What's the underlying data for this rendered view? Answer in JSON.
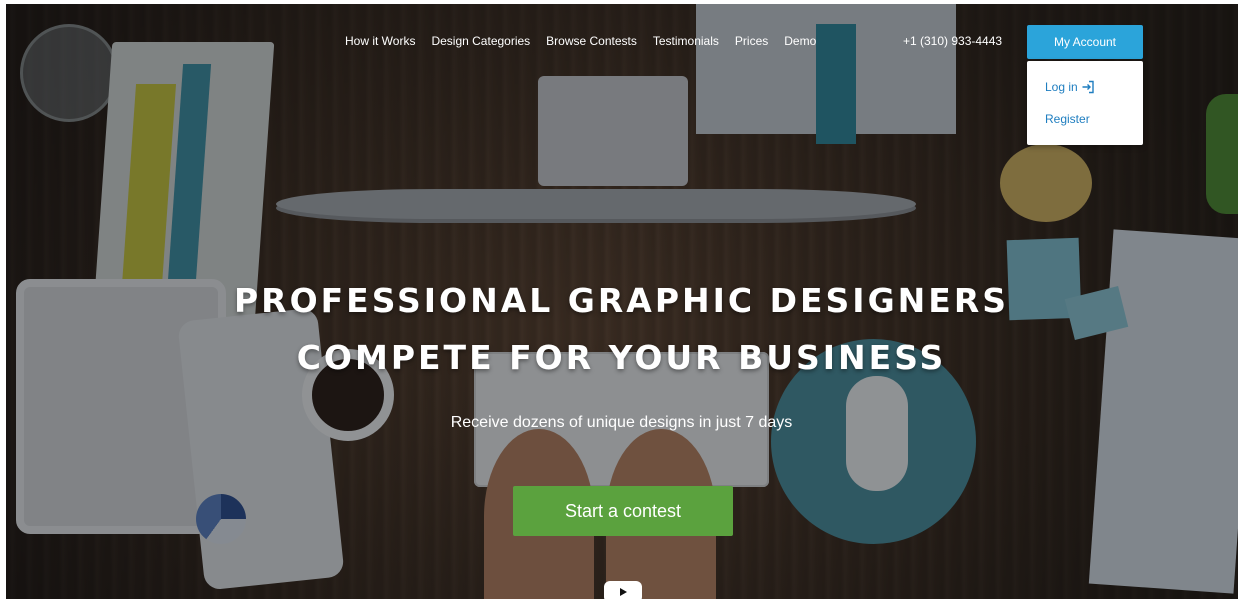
{
  "nav": {
    "items": [
      "How it Works",
      "Design Categories",
      "Browse Contests",
      "Testimonials",
      "Prices",
      "Demo"
    ],
    "phone": "+1 (310) 933-4443",
    "account_label": "My Account",
    "dropdown": {
      "login_label": "Log in",
      "register_label": "Register"
    }
  },
  "hero": {
    "headline_line1": "PROFESSIONAL GRAPHIC DESIGNERS",
    "headline_line2": "COMPETE FOR YOUR BUSINESS",
    "subtitle": "Receive dozens of unique designs in just 7 days",
    "cta_label": "Start a contest",
    "play_icon": "play-icon"
  },
  "colors": {
    "account_button": "#2ba4da",
    "cta_button": "#5ba23e",
    "link": "#1f7ec0"
  }
}
